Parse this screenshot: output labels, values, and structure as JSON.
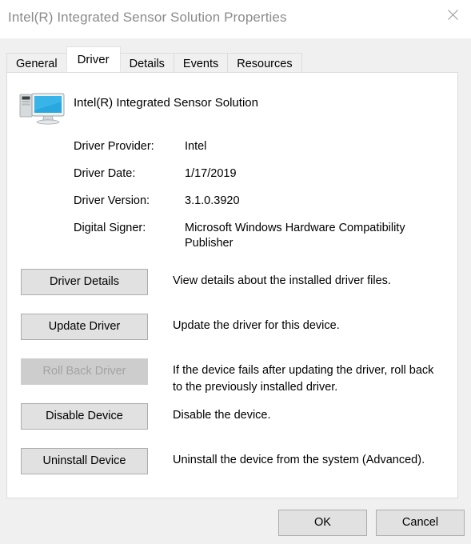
{
  "window": {
    "title": "Intel(R) Integrated Sensor Solution Properties",
    "close_icon": "close-icon"
  },
  "tabs": [
    {
      "label": "General",
      "active": false
    },
    {
      "label": "Driver",
      "active": true
    },
    {
      "label": "Details",
      "active": false
    },
    {
      "label": "Events",
      "active": false
    },
    {
      "label": "Resources",
      "active": false
    }
  ],
  "device": {
    "name": "Intel(R) Integrated Sensor Solution",
    "icon": "computer-icon"
  },
  "driver_info": [
    {
      "label": "Driver Provider:",
      "value": "Intel"
    },
    {
      "label": "Driver Date:",
      "value": "1/17/2019"
    },
    {
      "label": "Driver Version:",
      "value": "3.1.0.3920"
    },
    {
      "label": "Digital Signer:",
      "value": "Microsoft Windows Hardware Compatibility Publisher"
    }
  ],
  "actions": [
    {
      "button": "Driver Details",
      "description": "View details about the installed driver files.",
      "disabled": false
    },
    {
      "button": "Update Driver",
      "description": "Update the driver for this device.",
      "disabled": false
    },
    {
      "button": "Roll Back Driver",
      "description": "If the device fails after updating the driver, roll back to the previously installed driver.",
      "disabled": true
    },
    {
      "button": "Disable Device",
      "description": "Disable the device.",
      "disabled": false
    },
    {
      "button": "Uninstall Device",
      "description": "Uninstall the device from the system (Advanced).",
      "disabled": false
    }
  ],
  "footer": {
    "ok_label": "OK",
    "cancel_label": "Cancel"
  },
  "colors": {
    "window_background": "#f0f0f0",
    "panel_background": "#ffffff",
    "title_text": "#8b8b8b",
    "button_face": "#e1e1e1",
    "button_border": "#adadad",
    "disabled_face": "#cdcdcd",
    "disabled_text": "#a3a3a3",
    "monitor_screen": "#29a8e0"
  }
}
